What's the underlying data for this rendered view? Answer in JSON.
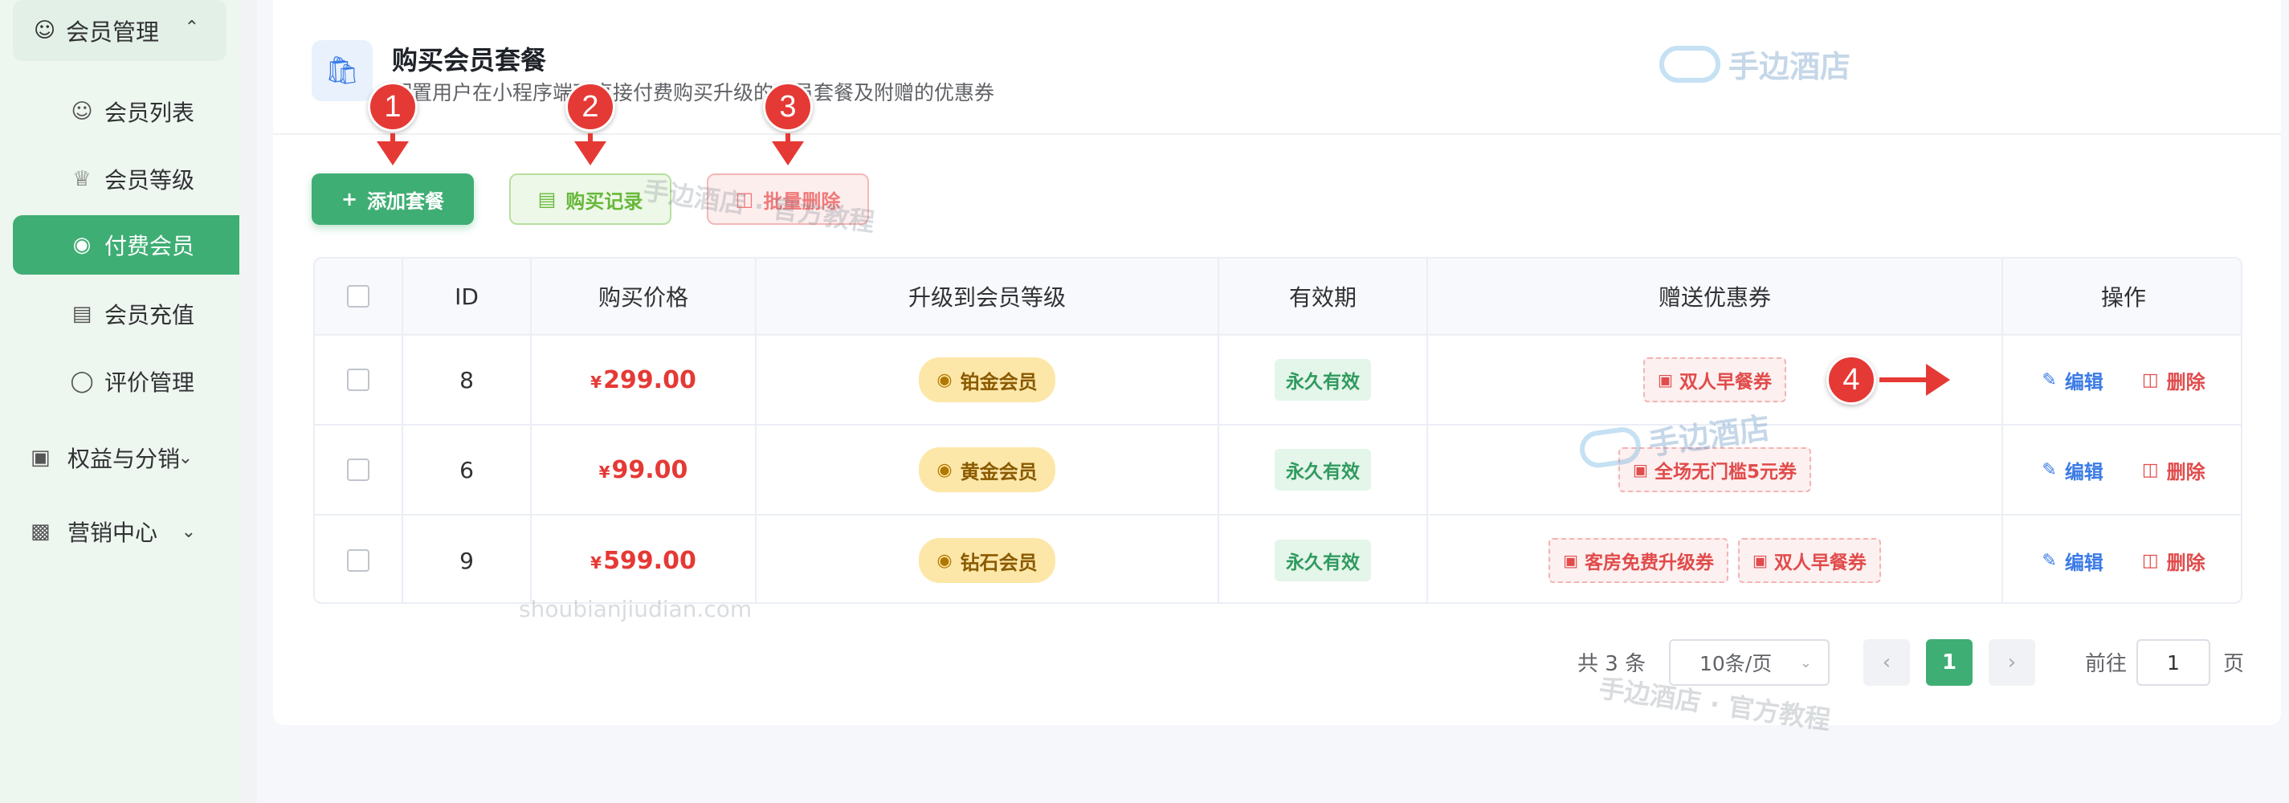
{
  "sidebar": {
    "group": {
      "label": "会员管理",
      "icon": "user-icon",
      "chevron": "chevron-up-icon"
    },
    "items": [
      {
        "label": "会员列表",
        "icon": "user-icon",
        "active": false
      },
      {
        "label": "会员等级",
        "icon": "crown-icon",
        "active": false
      },
      {
        "label": "付费会员",
        "icon": "medal-icon",
        "active": true
      },
      {
        "label": "会员充值",
        "icon": "wallet-icon",
        "active": false
      },
      {
        "label": "评价管理",
        "icon": "comment-icon",
        "active": false
      }
    ],
    "sections": [
      {
        "label": "权益与分销",
        "icon": "ticket-icon",
        "chevron": "chevron-down-icon"
      },
      {
        "label": "营销中心",
        "icon": "ad-icon",
        "chevron": "chevron-down-icon"
      }
    ]
  },
  "header": {
    "title": "购买会员套餐",
    "subtitle": "配置用户在小程序端可直接付费购买升级的会员套餐及附赠的优惠券",
    "icon": "shopping-bag-icon"
  },
  "toolbar": {
    "add_label": "添加套餐",
    "records_label": "购买记录",
    "batch_delete_label": "批量删除"
  },
  "markers": [
    "1",
    "2",
    "3",
    "4"
  ],
  "table": {
    "columns": [
      "ID",
      "购买价格",
      "升级到会员等级",
      "有效期",
      "赠送优惠券",
      "操作"
    ],
    "currency": "¥",
    "rows": [
      {
        "id": "8",
        "price": "299.00",
        "level": "铂金会员",
        "validity": "永久有效",
        "coupons": [
          "双人早餐券"
        ]
      },
      {
        "id": "6",
        "price": "99.00",
        "level": "黄金会员",
        "validity": "永久有效",
        "coupons": [
          "全场无门槛5元券"
        ]
      },
      {
        "id": "9",
        "price": "599.00",
        "level": "钻石会员",
        "validity": "永久有效",
        "coupons": [
          "客房免费升级券",
          "双人早餐券"
        ]
      }
    ],
    "edit_label": "编辑",
    "delete_label": "删除"
  },
  "pagination": {
    "total": "共 3 条",
    "page_size": "10条/页",
    "current_page": "1",
    "goto_prefix": "前往",
    "goto_value": "1",
    "goto_suffix": "页"
  },
  "watermarks": {
    "logo_text": "手边酒店",
    "tagline": "手边酒店 · 官方教程",
    "url": "shoubianjiudian.com"
  },
  "colors": {
    "primary": "#3fae74",
    "danger": "#e53935",
    "link": "#3b7be6",
    "gold_tag": "#fde7a8"
  }
}
